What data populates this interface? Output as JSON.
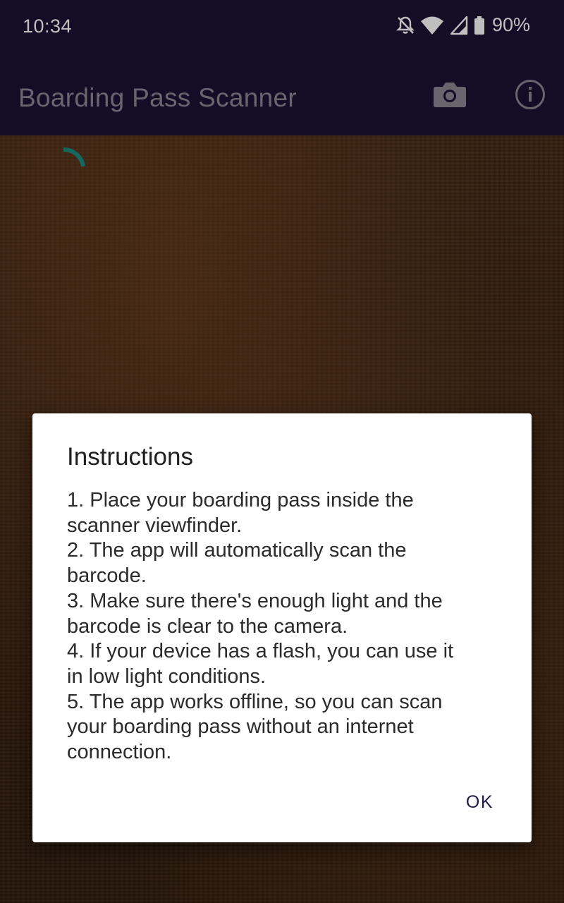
{
  "status_bar": {
    "time": "10:34",
    "battery": "90%",
    "icons": [
      "notifications-off-icon",
      "wifi-icon",
      "cell-signal-icon",
      "battery-icon"
    ]
  },
  "app_bar": {
    "title": "Boarding Pass Scanner",
    "actions": [
      "camera-icon",
      "info-icon"
    ]
  },
  "camera_preview": {
    "loading": true
  },
  "dialog": {
    "title": "Instructions",
    "lines": [
      "1. Place your boarding pass inside the",
      "scanner viewfinder.",
      "2. The app will automatically scan the",
      "barcode.",
      "3. Make sure there's enough light and the",
      "barcode is clear to the camera.",
      "4. If your device has a flash, you can use it",
      "in low light conditions.",
      "5. The app works offline, so you can scan",
      "your boarding pass without an internet",
      "connection."
    ],
    "ok_label": "OK"
  },
  "colors": {
    "app_bar": "#1a1233",
    "title_text": "#8b8795",
    "spinner": "#1e8a80",
    "dialog_button": "#231a4a"
  }
}
